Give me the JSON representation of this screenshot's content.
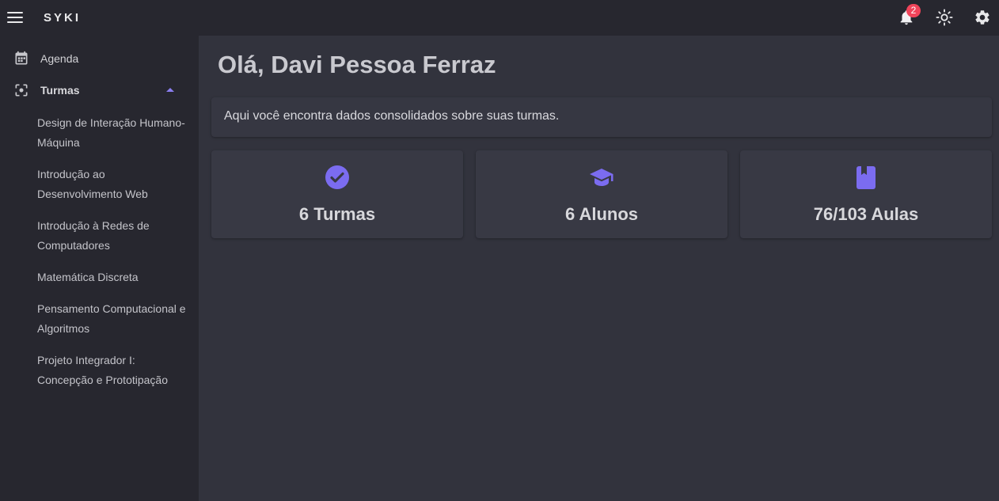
{
  "app": {
    "brand": "SYKI"
  },
  "header": {
    "notifications_count": "2",
    "icons": [
      "menu-icon",
      "bell-icon",
      "sun-icon",
      "gear-icon"
    ]
  },
  "sidebar": {
    "items": [
      {
        "label": "Agenda",
        "icon": "calendar-icon"
      },
      {
        "label": "Turmas",
        "icon": "center-focus-icon",
        "expanded": true
      }
    ],
    "subitems": [
      "Design de Interação Humano-Máquina",
      "Introdução ao Desenvolvimento Web",
      "Introdução à Redes de Computadores",
      "Matemática Discreta",
      "Pensamento Computacional e Algoritmos",
      "Projeto Integrador I: Concepção e Prototipação"
    ]
  },
  "main": {
    "title": "Olá, Davi Pessoa Ferraz",
    "info": "Aqui você encontra dados consolidados sobre suas turmas.",
    "cards": [
      {
        "value": "6 Turmas",
        "icon": "check-circle-icon"
      },
      {
        "value": "6 Alunos",
        "icon": "graduation-cap-icon"
      },
      {
        "value": "76/103 Aulas",
        "icon": "book-icon"
      }
    ]
  },
  "colors": {
    "accent": "#7b6cf0",
    "badge": "#f0445a",
    "background": "#32333d",
    "sidebar": "#27272f"
  }
}
